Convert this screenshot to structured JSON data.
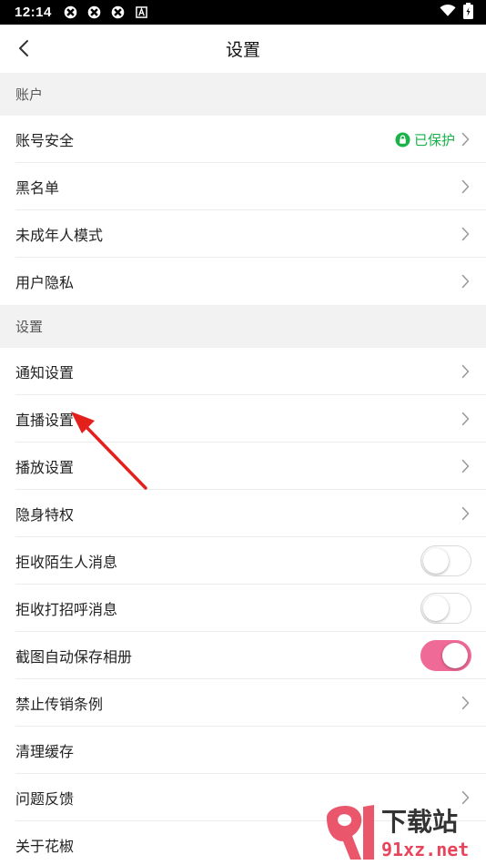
{
  "statusbar": {
    "time": "12:14"
  },
  "header": {
    "title": "设置"
  },
  "sections": {
    "account": "账户",
    "settings": "设置"
  },
  "account_items": [
    {
      "label": "账号安全",
      "badge": "已保护"
    },
    {
      "label": "黑名单"
    },
    {
      "label": "未成年人模式"
    },
    {
      "label": "用户隐私"
    }
  ],
  "settings_items": [
    {
      "label": "通知设置"
    },
    {
      "label": "直播设置"
    },
    {
      "label": "播放设置"
    },
    {
      "label": "隐身特权"
    },
    {
      "label": "拒收陌生人消息",
      "toggle": false
    },
    {
      "label": "拒收打招呼消息",
      "toggle": false
    },
    {
      "label": "截图自动保存相册",
      "toggle": true
    },
    {
      "label": "禁止传销条例"
    },
    {
      "label": "清理缓存"
    },
    {
      "label": "问题反馈"
    },
    {
      "label": "关于花椒"
    }
  ],
  "watermark": {
    "text_cn": "下载站",
    "text_url": "91xz.net"
  },
  "colors": {
    "accent_pink": "#f06a98",
    "protect_green": "#19b34a",
    "annotation_red": "#e3201c"
  }
}
